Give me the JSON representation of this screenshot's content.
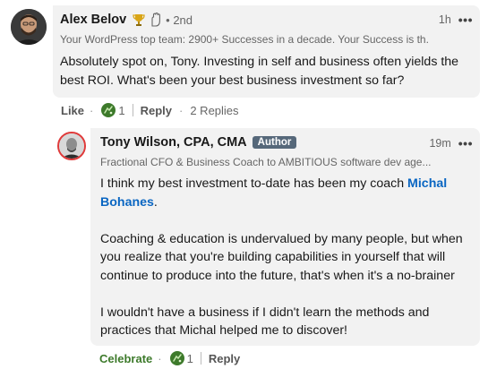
{
  "comment1": {
    "author": "Alex Belov",
    "degree": "• 2nd",
    "headline": "Your WordPress top team: 2900+ Successes in a decade. Your Success is th...",
    "time": "1h",
    "body": "Absolutely spot on, Tony. Investing in self and business often yields the best ROI. What's been your best business investment so far?",
    "actions": {
      "like": "Like",
      "reaction_count": "1",
      "reply": "Reply",
      "replies": "2 Replies"
    }
  },
  "comment2": {
    "author": "Tony Wilson, CPA, CMA",
    "badge": "Author",
    "headline": "Fractional CFO & Business Coach to AMBITIOUS software dev age...",
    "time": "19m",
    "body_p1_pre": "I think my best investment to-date has been my coach ",
    "body_p1_link": "Michal Bohanes",
    "body_p1_post": ".",
    "body_p2": "Coaching & education is undervalued by many people, but when you realize that you're building capabilities in yourself that will continue to produce into the future, that's when it's a no-brainer",
    "body_p3": "I wouldn't have a business if I didn't learn the methods and practices that Michal helped me to discover!",
    "actions": {
      "celebrate": "Celebrate",
      "reaction_count": "1",
      "reply": "Reply"
    }
  },
  "icons": {
    "more": "more-options-icon",
    "trophy": "trophy-icon",
    "hand": "raised-hand-icon",
    "celebrate": "celebrate-icon"
  },
  "colors": {
    "link": "#0a66c2",
    "author_badge": "#56687a",
    "bubble": "#f2f2f2",
    "celebrate_green": "#3d7a2b"
  }
}
